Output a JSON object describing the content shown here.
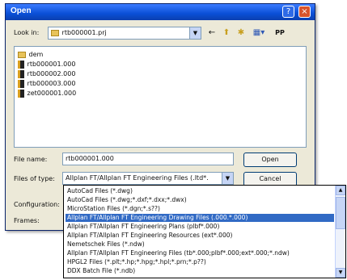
{
  "window": {
    "title": "Open",
    "help_glyph": "?",
    "close_glyph": "×"
  },
  "toolbar": {
    "look_in_label": "Look in:",
    "look_in_value": "rtb000001.prj",
    "back_glyph": "←",
    "up_glyph": "⬆",
    "newfolder_glyph": "✱",
    "views_glyph": "▦▾",
    "tools_glyph": "PP"
  },
  "files": [
    {
      "name": "dem",
      "type": "folder"
    },
    {
      "name": "rtb000001.000",
      "type": "file"
    },
    {
      "name": "rtb000002.000",
      "type": "file"
    },
    {
      "name": "rtb000003.000",
      "type": "file"
    },
    {
      "name": "zet000001.000",
      "type": "file"
    }
  ],
  "form": {
    "file_name_label": "File name:",
    "file_name_value": "rtb000001.000",
    "files_of_type_label": "Files of type:",
    "files_of_type_value": "Allplan FT/Allplan FT Engineering Files (.ltd*.",
    "configuration_label": "Configuration:",
    "frames_label": "Frames:"
  },
  "buttons": {
    "open": "Open",
    "cancel": "Cancel"
  },
  "file_types": [
    {
      "label": "AutoCad Files (*.dwg)",
      "selected": false
    },
    {
      "label": "AutoCad Files (*.dwg;*.dxf;*.dxx;*.dwx)",
      "selected": false
    },
    {
      "label": "MicroStation Files (*.dgn;*.s??)",
      "selected": false
    },
    {
      "label": "Allplan FT/Allplan FT Engineering Drawing Files (.000.*.000)",
      "selected": true
    },
    {
      "label": "Allplan FT/Allplan FT Engineering Plans (plbf*.000)",
      "selected": false
    },
    {
      "label": "Allplan FT/Allplan FT Engineering Resources (ext*.000)",
      "selected": false
    },
    {
      "label": "Nemetschek Files (*.ndw)",
      "selected": false
    },
    {
      "label": "Allplan FT/Allplan FT Engineering Files (tb*.000;plbf*.000;ext*.000;*.ndw)",
      "selected": false
    },
    {
      "label": "HPGL2 Files (*.plt;*.hp;*.hpg;*.hpl;*.prn;*.p??)",
      "selected": false
    },
    {
      "label": "DDX Batch File (*.ndb)",
      "selected": false
    }
  ],
  "colors": {
    "title_bar": "#0a4fd6",
    "selection": "#316ac5",
    "dialog_bg": "#ece9d8"
  }
}
